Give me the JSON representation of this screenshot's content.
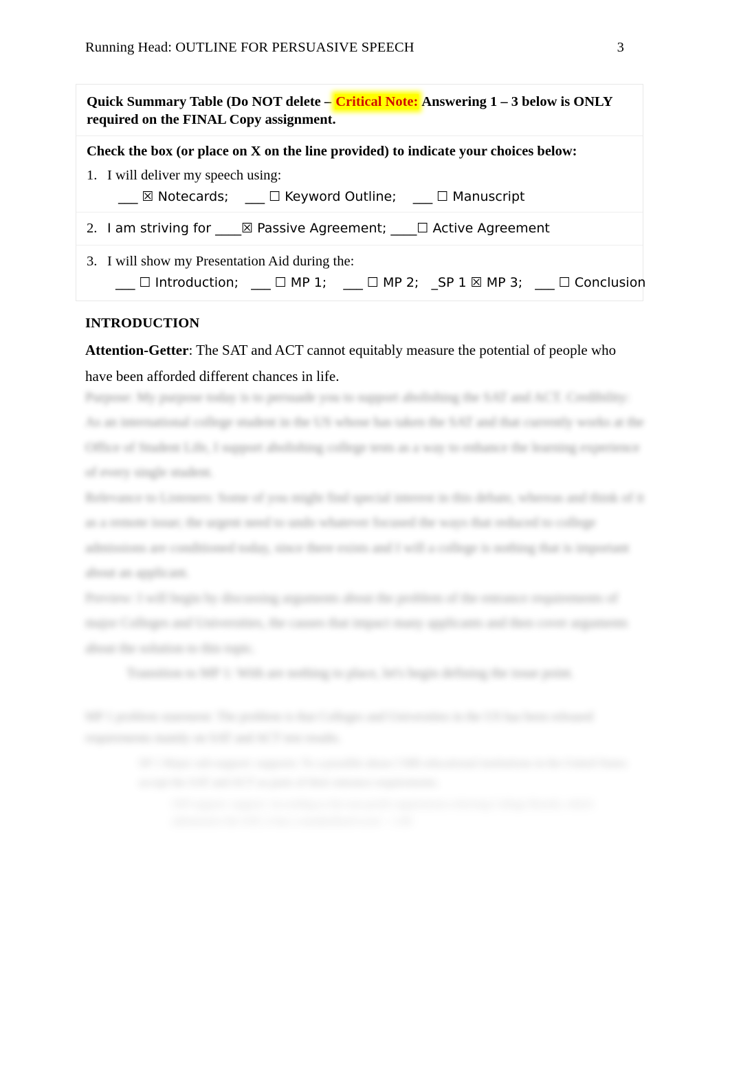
{
  "header": {
    "running_head": "Running Head: OUTLINE FOR PERSUASIVE SPEECH",
    "page_number": "3"
  },
  "summary_table": {
    "title_part1": "Quick Summary Table (Do NOT delete – ",
    "critical_note_label": "Critical Note:",
    "title_part2": " Answering 1 – 3 below is ONLY required on the FINAL Copy assignment.",
    "instruction": "Check the box (or place on X on the line provided) to indicate your choices below:",
    "questions": [
      {
        "number": "1.",
        "text": "I will deliver my speech using:",
        "options_line": "___ ☒ Notecards;    ___ ☐ Keyword Outline;    ___ ☐ Manuscript",
        "options": [
          {
            "blank": "___",
            "box": "☒",
            "label": "Notecards;",
            "checked": true
          },
          {
            "blank": "___",
            "box": "☐",
            "label": "Keyword Outline;",
            "checked": false
          },
          {
            "blank": "___",
            "box": "☐",
            "label": "Manuscript",
            "checked": false
          }
        ]
      },
      {
        "number": "2.",
        "text": "I am striving for  ____☒ Passive Agreement;    ____☐ Active Agreement",
        "options": [
          {
            "blank": "____",
            "box": "☒",
            "label": "Passive Agreement;",
            "checked": true
          },
          {
            "blank": "____",
            "box": "☐",
            "label": "Active Agreement",
            "checked": false
          }
        ]
      },
      {
        "number": "3.",
        "text": "I will show my Presentation Aid during the:",
        "options_line": "___ ☐ Introduction;   ___ ☐ MP 1;    ___ ☐ MP 2;   _SP 1 ☒ MP 3;   ___ ☐ Conclusion",
        "options": [
          {
            "blank": "___",
            "box": "☐",
            "label": "Introduction;",
            "checked": false
          },
          {
            "blank": "___",
            "box": "☐",
            "label": "MP 1;",
            "checked": false
          },
          {
            "blank": "___",
            "box": "☐",
            "label": "MP 2;",
            "checked": false
          },
          {
            "blank": "_SP 1",
            "box": "☒",
            "label": "MP 3;",
            "checked": true
          },
          {
            "blank": "___",
            "box": "☐",
            "label": "Conclusion",
            "checked": false
          }
        ]
      }
    ]
  },
  "introduction": {
    "heading": "INTRODUCTION",
    "attention_getter_label": "Attention-Getter",
    "attention_getter_text": ":  The SAT and ACT cannot equitably measure the potential of people who have been afforded different chances in life."
  },
  "obscured_body": {
    "note": "remaining body text is blurred and illegible in the source image",
    "line1": "Purpose:   My purpose today is to persuade you to support abolishing the SAT and ACT.",
    "line2": "Credibility:   As an international college student in the US whose has taken the SAT and that currently works at the Office of Student Life, I support abolishing college tests as a way to enhance the learning experience of every single student.",
    "line3": "Relevance to Listeners:   Some of you might find special interest in this debate, whereas and think of it as a remote issue; the urgent need to undo whatever focused the ways that reduced to college admissions are conditioned today, since there exists and I will a college is nothing that is important about an applicant.",
    "line4": "Preview:   I will begin by discussing arguments about the problem of the entrance requirements of major Colleges and Universities, the causes that impact many applicants and then cover arguments about the solution to this topic.",
    "line5": "Transition to MP 1:     With are nothing to place, let's begin defining the issue point.",
    "line6": "MP 1 problem statement: The problem is that Colleges and Universities in the US has been released requirements mainly on SAT and ACT test results.",
    "line7": "SP 1 Major sub-support:   supports: To a possible abuse I MB educational institutions in the United States accept the SAT and ACT as parts of their entrance requirements.",
    "line8": "SSP support:   support:   According to the non-profit organization referring College Boards, which administers the SAT, it has a standardized score – 1.68"
  }
}
